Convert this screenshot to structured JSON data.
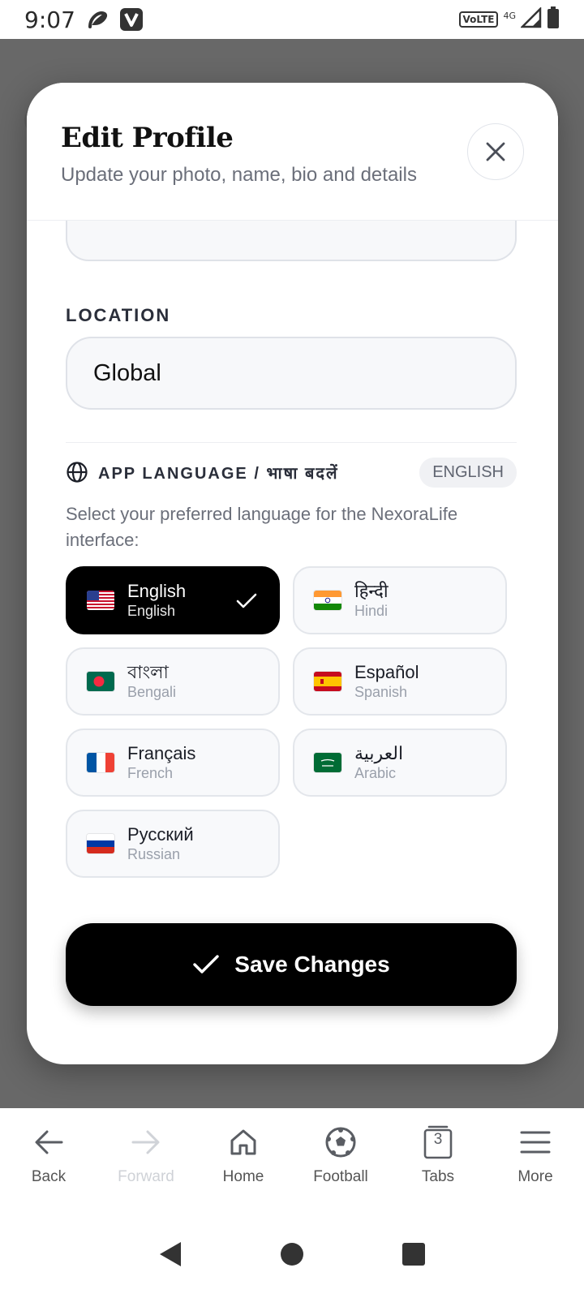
{
  "status_bar": {
    "time": "9:07",
    "network_badge": "VoLTE",
    "network_type": "4G",
    "icons": [
      "airtel-icon",
      "v-app-icon",
      "signal-icon",
      "battery-icon"
    ]
  },
  "modal": {
    "title": "Edit Profile",
    "subtitle": "Update your photo, name, bio and details",
    "close_icon": "close-icon"
  },
  "location": {
    "label": "LOCATION",
    "value": "Global"
  },
  "language": {
    "title": "APP LANGUAGE / भाषा बदलें",
    "current_badge": "ENGLISH",
    "description": "Select your preferred language for the NexoraLife interface:",
    "options": [
      {
        "native": "English",
        "english": "English",
        "flag": "us-flag",
        "selected": true
      },
      {
        "native": "हिन्दी",
        "english": "Hindi",
        "flag": "india-flag",
        "selected": false
      },
      {
        "native": "বাংলা",
        "english": "Bengali",
        "flag": "bangladesh-flag",
        "selected": false
      },
      {
        "native": "Español",
        "english": "Spanish",
        "flag": "spain-flag",
        "selected": false
      },
      {
        "native": "Français",
        "english": "French",
        "flag": "france-flag",
        "selected": false
      },
      {
        "native": "العربية",
        "english": "Arabic",
        "flag": "saudi-flag",
        "selected": false
      },
      {
        "native": "Русский",
        "english": "Russian",
        "flag": "russia-flag",
        "selected": false
      }
    ]
  },
  "save_button": {
    "label": "Save Changes"
  },
  "bottom_nav": {
    "items": [
      {
        "label": "Back",
        "icon": "arrow-left-icon",
        "disabled": false
      },
      {
        "label": "Forward",
        "icon": "arrow-right-icon",
        "disabled": true
      },
      {
        "label": "Home",
        "icon": "home-icon",
        "disabled": false
      },
      {
        "label": "Football",
        "icon": "football-icon",
        "disabled": false
      },
      {
        "label": "Tabs",
        "icon": "tabs-icon",
        "badge": "3",
        "disabled": false
      },
      {
        "label": "More",
        "icon": "menu-icon",
        "disabled": false
      }
    ]
  },
  "colors": {
    "accent": "#000000",
    "backdrop": "#686868",
    "muted_text": "#6b6f7a"
  }
}
